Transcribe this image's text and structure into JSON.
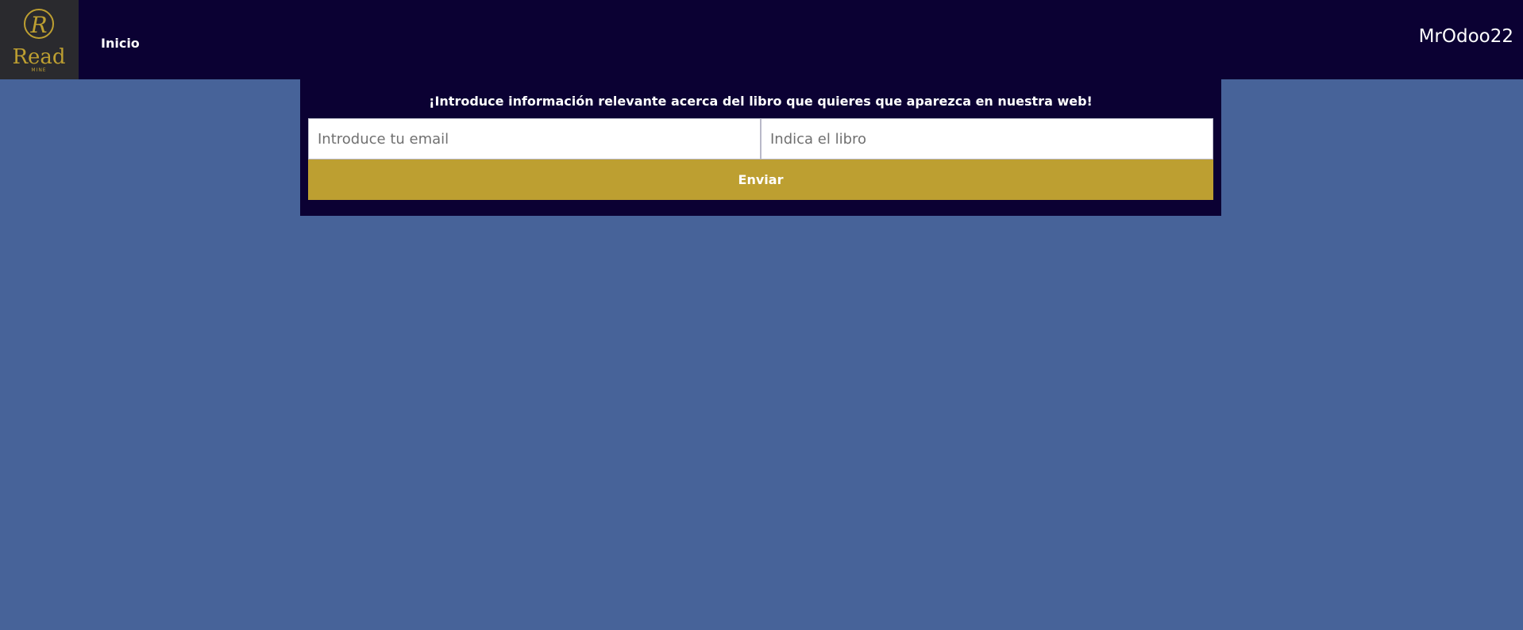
{
  "header": {
    "logo_text": "Read",
    "logo_subtext": "MINE",
    "logo_initial": "R",
    "nav_home": "Inicio",
    "username": "MrOdoo22"
  },
  "form": {
    "title": "¡Introduce información relevante acerca del libro que quieres que aparezca en nuestra web!",
    "email_placeholder": "Introduce tu email",
    "book_placeholder": "Indica el libro",
    "submit_label": "Enviar"
  },
  "colors": {
    "page_background": "#476399",
    "header_background": "#0b0133",
    "logo_background": "#2a2a2e",
    "accent_gold": "#bd9f31"
  },
  "icons": {
    "logo": "readmine-logo-icon"
  }
}
